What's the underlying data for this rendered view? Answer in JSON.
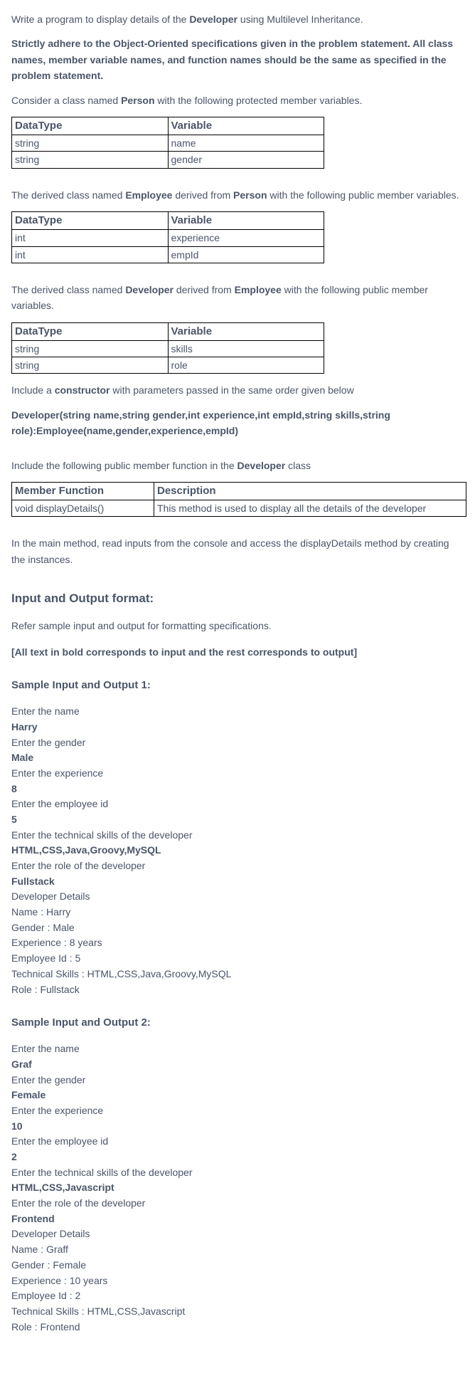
{
  "intro": {
    "line1_pre": "Write a program to display details of the ",
    "line1_bold": "Developer",
    "line1_post": " using Multilevel Inheritance.",
    "strict": "Strictly adhere to the Object-Oriented specifications given in the problem statement. All class names, member variable names, and function names should be the same as specified in the problem statement.",
    "person_pre": "Consider a class named ",
    "person_bold": "Person",
    "person_post": " with the following protected member variables."
  },
  "table_headers": {
    "datatype": "DataType",
    "variable": "Variable"
  },
  "person_table": [
    {
      "dt": "string",
      "var": "name"
    },
    {
      "dt": "string",
      "var": "gender"
    }
  ],
  "employee_text": {
    "pre": "The derived class named ",
    "b1": "Employee",
    "mid": " derived from ",
    "b2": "Person",
    "post": " with the following public member variables."
  },
  "employee_table": [
    {
      "dt": "int",
      "var": "experience"
    },
    {
      "dt": "int",
      "var": "empId"
    }
  ],
  "developer_text": {
    "pre": "The derived class named ",
    "b1": "Developer",
    "mid": " derived from ",
    "b2": "Employee",
    "post": " with the following public member variables."
  },
  "developer_table": [
    {
      "dt": "string",
      "var": "skills"
    },
    {
      "dt": "string",
      "var": "role"
    }
  ],
  "constructor_text": {
    "pre": "Include a ",
    "b": "constructor",
    "post": " with parameters passed in the same order given below"
  },
  "constructor_sig": "Developer(string name,string gender,int experience,int empId,string skills,string role):Employee(name,gender,experience,empId)",
  "member_fn_text": {
    "pre": "Include the following public member function in the ",
    "b": "Developer",
    "post": "  class"
  },
  "fn_headers": {
    "mf": "Member Function",
    "desc": "Description"
  },
  "fn_table": [
    {
      "mf": "void displayDetails()",
      "desc": "This method is used to display all the details of the developer"
    }
  ],
  "main_text": "In the main method, read inputs from the console and access the displayDetails method by creating the instances.",
  "io_heading": "Input and Output format:",
  "io_refer": "Refer sample input and output for formatting specifications.",
  "io_note": "[All text in bold corresponds to input and the rest corresponds to output]",
  "sample1_heading": "Sample Input and Output 1:",
  "sample1": [
    {
      "t": "Enter the name",
      "b": false
    },
    {
      "t": "Harry",
      "b": true
    },
    {
      "t": "Enter the gender",
      "b": false
    },
    {
      "t": "Male",
      "b": true
    },
    {
      "t": "Enter the experience",
      "b": false
    },
    {
      "t": "8",
      "b": true
    },
    {
      "t": "Enter the employee id",
      "b": false
    },
    {
      "t": "5",
      "b": true
    },
    {
      "t": "Enter the technical skills of the developer",
      "b": false
    },
    {
      "t": "HTML,CSS,Java,Groovy,MySQL",
      "b": true
    },
    {
      "t": "Enter the role of the developer",
      "b": false
    },
    {
      "t": "Fullstack",
      "b": true
    },
    {
      "t": "Developer Details",
      "b": false
    },
    {
      "t": "Name : Harry",
      "b": false
    },
    {
      "t": "Gender : Male",
      "b": false
    },
    {
      "t": "Experience : 8 years",
      "b": false
    },
    {
      "t": "Employee Id : 5",
      "b": false
    },
    {
      "t": "Technical Skills : HTML,CSS,Java,Groovy,MySQL",
      "b": false
    },
    {
      "t": "Role : Fullstack",
      "b": false
    }
  ],
  "sample2_heading": "Sample Input and Output 2:",
  "sample2": [
    {
      "t": "Enter the name",
      "b": false
    },
    {
      "t": "Graf",
      "b": true
    },
    {
      "t": "Enter the gender",
      "b": false
    },
    {
      "t": "Female",
      "b": true
    },
    {
      "t": "Enter the experience",
      "b": false
    },
    {
      "t": "10",
      "b": true
    },
    {
      "t": "Enter the employee id",
      "b": false
    },
    {
      "t": "2",
      "b": true
    },
    {
      "t": "Enter the technical skills of the developer",
      "b": false
    },
    {
      "t": "HTML,CSS,Javascript",
      "b": true
    },
    {
      "t": "Enter the role of the developer",
      "b": false
    },
    {
      "t": "Frontend",
      "b": true
    },
    {
      "t": "Developer Details",
      "b": false
    },
    {
      "t": "Name : Graff",
      "b": false
    },
    {
      "t": "Gender : Female",
      "b": false
    },
    {
      "t": "Experience : 10 years",
      "b": false
    },
    {
      "t": "Employee Id : 2",
      "b": false
    },
    {
      "t": "Technical Skills : HTML,CSS,Javascript",
      "b": false
    },
    {
      "t": "Role : Frontend",
      "b": false
    }
  ]
}
